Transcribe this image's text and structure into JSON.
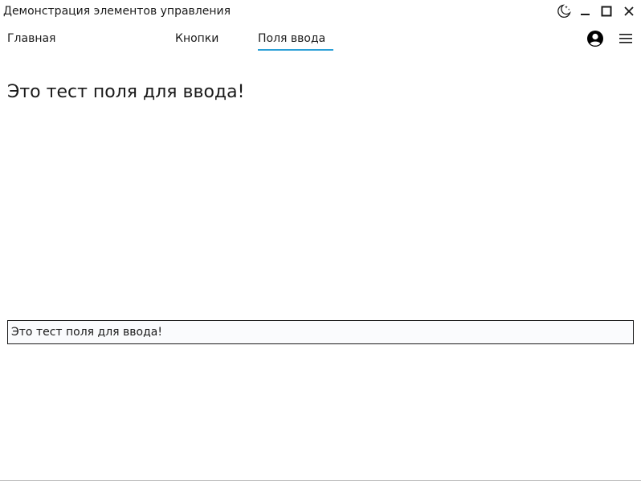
{
  "window": {
    "title": "Демонстрация элементов управления",
    "controls": {
      "theme_icon": "moon-icon",
      "minimize_icon": "minimize-icon",
      "maximize_icon": "maximize-icon",
      "close_icon": "close-icon"
    }
  },
  "nav": {
    "tabs": [
      {
        "label": "Главная",
        "active": false
      },
      {
        "label": "Кнопки",
        "active": false
      },
      {
        "label": "Поля ввода",
        "active": true
      }
    ],
    "account_icon": "account-icon",
    "menu_icon": "hamburger-menu-icon",
    "accent_color": "#2a9fd6"
  },
  "main": {
    "heading": "Это тест поля для ввода!",
    "input_value": "Это тест поля для ввода!"
  }
}
